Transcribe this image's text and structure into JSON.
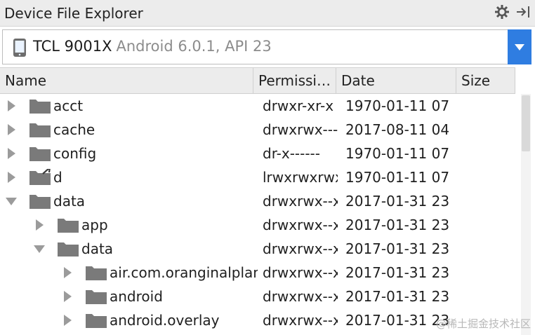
{
  "panel": {
    "title": "Device File Explorer"
  },
  "device": {
    "name": "TCL 9001X",
    "info": "Android 6.0.1, API 23"
  },
  "columns": [
    "Name",
    "Permissi…",
    "Date",
    "Size"
  ],
  "rows": [
    {
      "name": "acct",
      "perm": "drwxr-xr-x",
      "date": "1970-01-11 07",
      "level": 0,
      "expanded": false,
      "link": false
    },
    {
      "name": "cache",
      "perm": "drwxrwx---",
      "date": "2017-08-11 04",
      "level": 0,
      "expanded": false,
      "link": false
    },
    {
      "name": "config",
      "perm": "dr-x------",
      "date": "1970-01-11 07",
      "level": 0,
      "expanded": false,
      "link": false
    },
    {
      "name": "d",
      "perm": "lrwxrwxrwx",
      "date": "1970-01-11 07",
      "level": 0,
      "expanded": false,
      "link": true
    },
    {
      "name": "data",
      "perm": "drwxrwx--x",
      "date": "2017-01-31 23",
      "level": 0,
      "expanded": true,
      "link": false
    },
    {
      "name": "app",
      "perm": "drwxrwx--x",
      "date": "2017-01-31 23",
      "level": 1,
      "expanded": false,
      "link": false
    },
    {
      "name": "data",
      "perm": "drwxrwx--x",
      "date": "2017-01-31 23",
      "level": 1,
      "expanded": true,
      "link": false
    },
    {
      "name": "air.com.oranginalplan",
      "perm": "drwxrwx--x",
      "date": "2017-01-31 23",
      "level": 2,
      "expanded": false,
      "link": false
    },
    {
      "name": "android",
      "perm": "drwxrwx--x",
      "date": "2017-01-31 23",
      "level": 2,
      "expanded": false,
      "link": false
    },
    {
      "name": "android.overlay",
      "perm": "drwxrwx--x",
      "date": "2017-01-31 23",
      "level": 2,
      "expanded": false,
      "link": false
    }
  ],
  "watermark": "@稀土掘金技术社区",
  "colors": {
    "accent": "#2f7de1",
    "folder": "#7a7a7a",
    "arrow": "#9b9b9b"
  }
}
